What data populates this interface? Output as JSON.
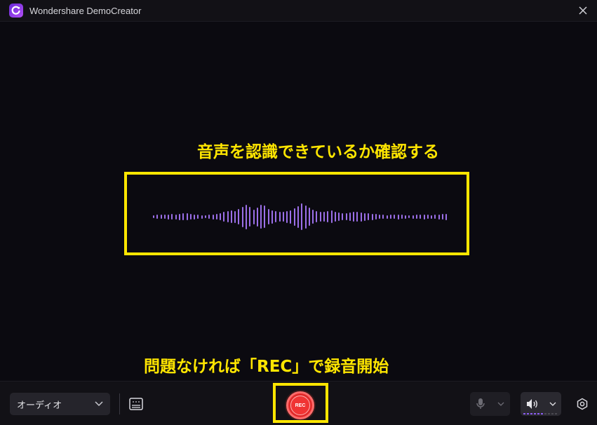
{
  "window": {
    "title": "Wondershare DemoCreator",
    "icons": {
      "app": "democreator-logo-icon",
      "close": "close-icon"
    }
  },
  "annotations": {
    "top_text": "音声を認識できているか確認する",
    "bottom_text": "問題なければ「REC」で録音開始",
    "highlight_color": "#ffe600"
  },
  "waveform": {
    "color": "#9b6fe8",
    "levels": [
      0.1,
      0.14,
      0.14,
      0.16,
      0.18,
      0.2,
      0.18,
      0.22,
      0.24,
      0.24,
      0.2,
      0.18,
      0.16,
      0.12,
      0.1,
      0.14,
      0.18,
      0.2,
      0.26,
      0.34,
      0.4,
      0.46,
      0.42,
      0.55,
      0.72,
      0.88,
      0.7,
      0.52,
      0.68,
      0.84,
      0.8,
      0.56,
      0.48,
      0.4,
      0.34,
      0.36,
      0.42,
      0.48,
      0.62,
      0.78,
      0.96,
      0.82,
      0.64,
      0.5,
      0.4,
      0.36,
      0.34,
      0.4,
      0.44,
      0.34,
      0.3,
      0.26,
      0.24,
      0.3,
      0.34,
      0.36,
      0.32,
      0.28,
      0.24,
      0.22,
      0.2,
      0.16,
      0.14,
      0.12,
      0.14,
      0.16,
      0.18,
      0.14,
      0.12,
      0.1,
      0.12,
      0.14,
      0.16,
      0.18,
      0.14,
      0.12,
      0.16,
      0.18,
      0.2,
      0.22
    ]
  },
  "toolbar": {
    "audio_source": {
      "selected": "オーディオ",
      "icon": "chevron-down-icon"
    },
    "caption_button": {
      "icon": "caption-keyboard-icon"
    },
    "rec_button": {
      "label": "REC",
      "color": "#e02b2b"
    },
    "microphone": {
      "icon": "microphone-icon",
      "enabled": false
    },
    "speaker": {
      "icon": "speaker-icon",
      "enabled": true,
      "level": 0.6
    },
    "settings": {
      "icon": "settings-gear-icon"
    }
  }
}
